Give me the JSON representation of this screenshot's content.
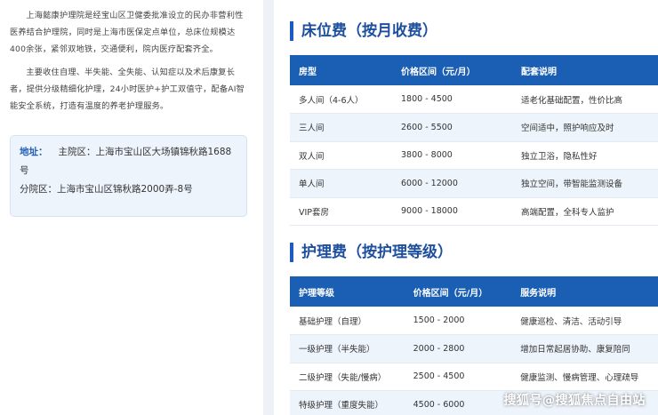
{
  "intro": {
    "paragraph1": "上海懿康护理院是经宝山区卫健委批准设立的民办非营利性医养结合护理院，同时是上海市医保定点单位，总床位规模达400余张，紧邻双地铁，交通便利，院内医疗配套齐全。",
    "paragraph2": "主要收住自理、半失能、全失能、认知症以及术后康复长者，提供分级精细化护理，24小时医护+护工双值守，配备AI智能安全系统，打造有温度的养老护理服务。"
  },
  "address": {
    "label": "地址：",
    "main": "主院区：上海市宝山区大场镇锦秋路1688号",
    "branch": "分院区：上海市宝山区锦秋路2000弄-8号"
  },
  "bed_section": {
    "title": "床位费（按月收费）",
    "headers": [
      "房型",
      "价格区间（元/月）",
      "配套说明"
    ],
    "rows": [
      [
        "多人间（4-6人）",
        "1800 - 4500",
        "适老化基础配置，性价比高"
      ],
      [
        "三人间",
        "2600 - 5500",
        "空间适中，照护响应及时"
      ],
      [
        "双人间",
        "3800 - 8000",
        "独立卫浴，隐私性好"
      ],
      [
        "单人间",
        "6000 - 12000",
        "独立空间，带智能监测设备"
      ],
      [
        "VIP套房",
        "9000 - 18000",
        "高端配置，全科专人监护"
      ]
    ]
  },
  "care_section": {
    "title": "护理费（按护理等级）",
    "headers": [
      "护理等级",
      "价格区间（元/月）",
      "服务说明"
    ],
    "rows": [
      [
        "基础护理（自理）",
        "1500 - 2000",
        "健康巡检、清洁、活动引导"
      ],
      [
        "一级护理（半失能）",
        "2000 - 2800",
        "增加日常起居协助、康复陪同"
      ],
      [
        "二级护理（失能/慢病）",
        "2500 - 4500",
        "健康监测、慢病管理、心理疏导"
      ],
      [
        "特级护理（重度失能）",
        "4500 - 6000",
        ""
      ]
    ]
  },
  "watermark": "搜狐号@搜狐焦点自由站"
}
